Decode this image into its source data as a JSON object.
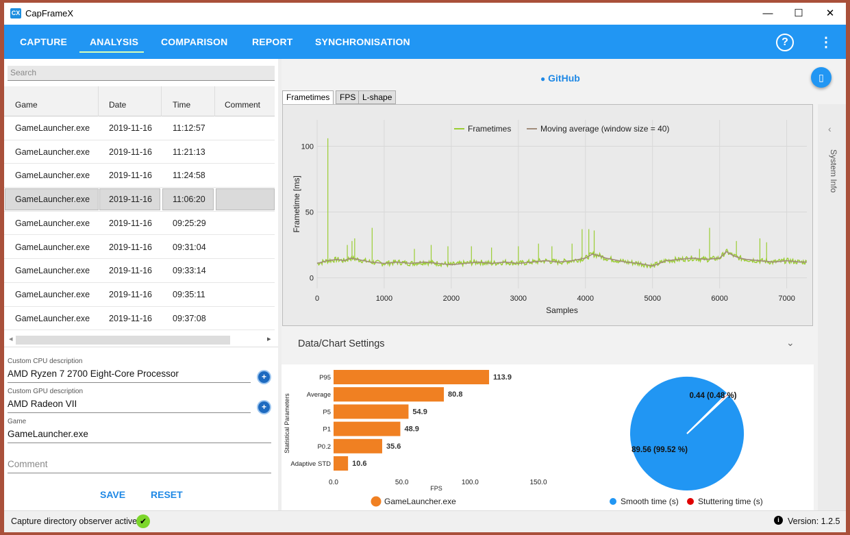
{
  "window": {
    "title": "CapFrameX",
    "minimize": "—",
    "maximize": "☐",
    "close": "✕"
  },
  "nav": {
    "tabs": [
      "CAPTURE",
      "ANALYSIS",
      "COMPARISON",
      "REPORT",
      "SYNCHRONISATION"
    ],
    "active": "ANALYSIS",
    "help": "?",
    "menu": "⋮"
  },
  "search": {
    "placeholder": "Search"
  },
  "table": {
    "headers": [
      "Game",
      "Date",
      "Time",
      "Comment"
    ],
    "rows": [
      [
        "GameLauncher.exe",
        "2019-11-16",
        "11:12:57"
      ],
      [
        "GameLauncher.exe",
        "2019-11-16",
        "11:21:13"
      ],
      [
        "GameLauncher.exe",
        "2019-11-16",
        "11:24:58"
      ],
      [
        "GameLauncher.exe",
        "2019-11-16",
        "11:06:20"
      ],
      [
        "GameLauncher.exe",
        "2019-11-16",
        "09:25:29"
      ],
      [
        "GameLauncher.exe",
        "2019-11-16",
        "09:31:04"
      ],
      [
        "GameLauncher.exe",
        "2019-11-16",
        "09:33:14"
      ],
      [
        "GameLauncher.exe",
        "2019-11-16",
        "09:35:11"
      ],
      [
        "GameLauncher.exe",
        "2019-11-16",
        "09:37:08"
      ]
    ],
    "selected_index": 3
  },
  "form": {
    "cpu_label": "Custom CPU description",
    "cpu_value": "AMD Ryzen 7 2700 Eight-Core Processor",
    "gpu_label": "Custom GPU description",
    "gpu_value": "AMD Radeon VII",
    "game_label": "Game",
    "game_value": "GameLauncher.exe",
    "comment_placeholder": "Comment",
    "save": "SAVE",
    "reset": "RESET"
  },
  "right": {
    "github": "GitHub",
    "chart_tabs": [
      "Frametimes",
      "FPS",
      "L-shape"
    ],
    "active_chart_tab": "Frametimes",
    "settings_title": "Data/Chart Settings",
    "system_info": "System Info"
  },
  "status": {
    "observer": "Capture directory observer active:",
    "version": "Version: 1.2.5"
  },
  "colors": {
    "accent": "#2196f3",
    "frametimes": "#9acd32",
    "moving_avg": "#a08c7a",
    "bars": "#f08022",
    "smooth": "#2196f3",
    "stutter": "#e00000"
  },
  "chart_data": [
    {
      "type": "line",
      "xlabel": "Samples",
      "ylabel": "Frametime [ms]",
      "xlim": [
        0,
        7300
      ],
      "ylim": [
        -8,
        120
      ],
      "xticks": [
        0,
        1000,
        2000,
        3000,
        4000,
        5000,
        6000,
        7000
      ],
      "yticks": [
        0,
        50,
        100
      ],
      "legend": [
        "Frametimes",
        "Moving average (window size = 40)"
      ],
      "legend_position": "top-center",
      "grid": true,
      "series": [
        {
          "name": "Moving average (window size = 40)",
          "x": [
            0,
            150,
            300,
            400,
            500,
            600,
            700,
            800,
            1000,
            1200,
            1400,
            1600,
            1800,
            2000,
            2200,
            2400,
            2600,
            2800,
            3000,
            3200,
            3400,
            3600,
            3800,
            4000,
            4100,
            4200,
            4300,
            4400,
            4600,
            4800,
            5000,
            5200,
            5400,
            5600,
            5800,
            6000,
            6100,
            6200,
            6300,
            6400,
            6600,
            6800,
            7000,
            7200,
            7300
          ],
          "y": [
            11,
            13,
            14,
            13,
            15,
            14,
            13,
            12,
            11,
            12,
            11,
            12,
            11,
            10,
            11,
            12,
            11,
            12,
            11,
            12,
            13,
            12,
            13,
            15,
            18,
            17,
            15,
            14,
            12,
            11,
            9,
            13,
            14,
            15,
            14,
            15,
            20,
            17,
            15,
            14,
            13,
            12,
            13,
            12,
            12
          ]
        }
      ],
      "spikes": [
        [
          160,
          106
        ],
        [
          450,
          25
        ],
        [
          520,
          28
        ],
        [
          560,
          30
        ],
        [
          820,
          38
        ],
        [
          1450,
          22
        ],
        [
          1700,
          25
        ],
        [
          1950,
          24
        ],
        [
          2300,
          24
        ],
        [
          2600,
          23
        ],
        [
          3000,
          24
        ],
        [
          3300,
          26
        ],
        [
          3500,
          24
        ],
        [
          3800,
          26
        ],
        [
          3950,
          37
        ],
        [
          4050,
          37
        ],
        [
          4130,
          36
        ],
        [
          5700,
          22
        ],
        [
          5850,
          38
        ],
        [
          6250,
          28
        ],
        [
          6600,
          30
        ],
        [
          6700,
          27
        ]
      ]
    },
    {
      "type": "bar",
      "ylabel": "Statistical Parameters",
      "xlabel": "FPS",
      "categories": [
        "P95",
        "Average",
        "P5",
        "P1",
        "P0.2",
        "Adaptive STD"
      ],
      "values": [
        113.9,
        80.8,
        54.9,
        48.9,
        35.6,
        10.6
      ],
      "xlim": [
        0,
        150
      ],
      "xticks": [
        "0.0",
        "50.0",
        "100.0",
        "150.0"
      ],
      "legend": "GameLauncher.exe"
    },
    {
      "type": "pie",
      "labels": [
        "Smooth time (s)",
        "Stuttering time (s)"
      ],
      "values": [
        89.56,
        0.44
      ],
      "data_labels": [
        "89.56 (99.52 %)",
        "0.44 (0.48 %)"
      ]
    }
  ]
}
